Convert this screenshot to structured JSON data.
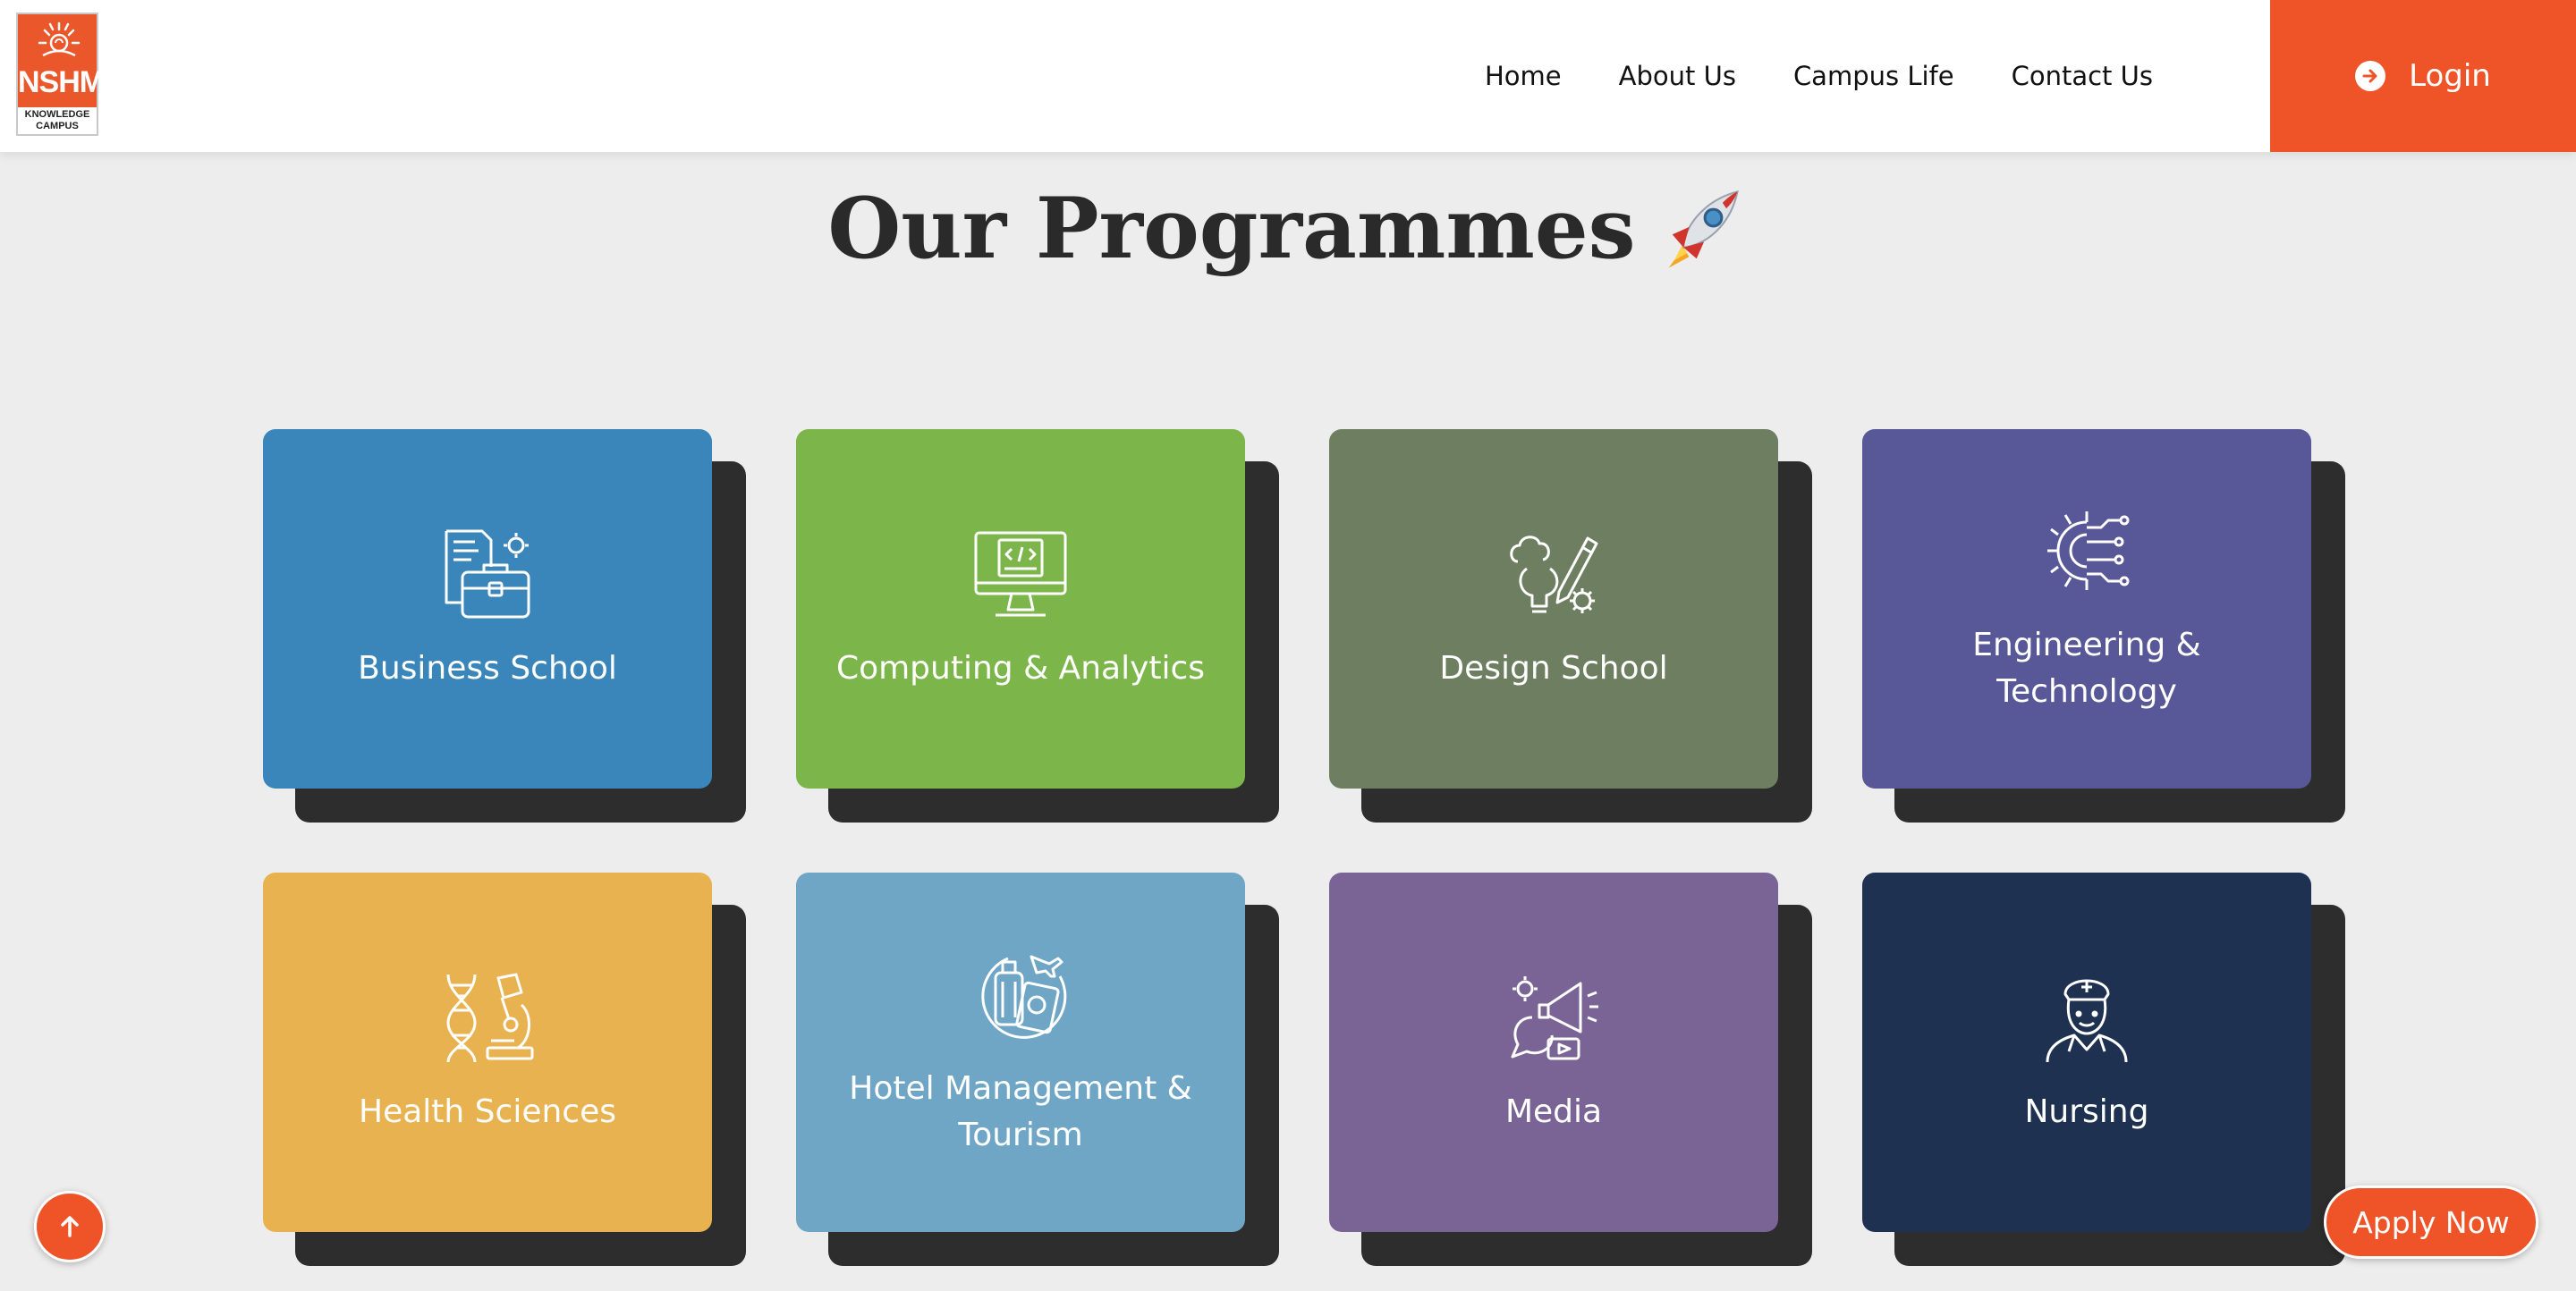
{
  "brand": {
    "logo_text": "NSHM",
    "logo_subtext": "KNOWLEDGE CAMPUS",
    "accent_color": "#ef5428"
  },
  "nav": {
    "items": [
      {
        "label": "Home"
      },
      {
        "label": "About Us"
      },
      {
        "label": "Campus Life"
      },
      {
        "label": "Contact Us"
      }
    ],
    "login_label": "Login",
    "login_icon": "arrow-circle-right-icon"
  },
  "section": {
    "title": "Our Programmes",
    "title_icon": "rocket-icon"
  },
  "programmes": [
    {
      "label": "Business School",
      "color": "#3a86ba",
      "icon": "briefcase-document-icon"
    },
    {
      "label": "Computing & Analytics",
      "color": "#7cb54a",
      "icon": "computer-code-icon"
    },
    {
      "label": "Design School",
      "color": "#6e7e61",
      "icon": "design-bulb-pencil-icon"
    },
    {
      "label": "Engineering &\nTechnology",
      "color": "#585798",
      "icon": "gear-circuit-icon"
    },
    {
      "label": "Health Sciences",
      "color": "#e8b250",
      "icon": "dna-microscope-icon"
    },
    {
      "label": "Hotel Management &\nTourism",
      "color": "#70a6c5",
      "icon": "luggage-passport-icon"
    },
    {
      "label": "Media",
      "color": "#7a6495",
      "icon": "megaphone-media-icon"
    },
    {
      "label": "Nursing",
      "color": "#1e3151",
      "icon": "nurse-icon"
    }
  ],
  "floating": {
    "scroll_top_icon": "arrow-up-icon",
    "apply_label": "Apply Now"
  }
}
